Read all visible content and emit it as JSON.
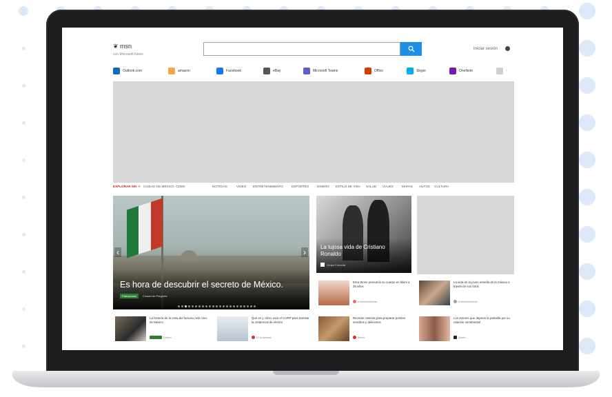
{
  "header": {
    "logo_text": "msn",
    "logo_subtitle": "con Microsoft News",
    "search_placeholder": "",
    "sign_in": "Iniciar sesión"
  },
  "quick_links": [
    {
      "label": "Outlook.com",
      "color": "#0f6cbd"
    },
    {
      "label": "amazon",
      "color": "#f3a847"
    },
    {
      "label": "Facebook",
      "color": "#1877f2"
    },
    {
      "label": "eBay",
      "color": "#555555"
    },
    {
      "label": "Microsoft Teams",
      "color": "#5b5fc7"
    },
    {
      "label": "Office",
      "color": "#d83b01"
    },
    {
      "label": "Skype",
      "color": "#00aff0"
    },
    {
      "label": "OneNote",
      "color": "#7719aa"
    }
  ],
  "categories": {
    "highlight": "EXPLORAR SIN",
    "items": [
      "CIUDAD DE MÉXICO, CDMX",
      "NOTICIAS",
      "VIDEO",
      "ENTRETENIMIENTO",
      "DEPORTES",
      "DINERO",
      "ESTILO DE VIDA",
      "SALUD",
      "VIAJES",
      "MAPAS",
      "AUTOS",
      "CULTURA"
    ]
  },
  "hero": {
    "title": "Es hora de descubrir el secreto de México.",
    "badge": "Patrocinado",
    "source": "Ciudad de Pregunta"
  },
  "feature": {
    "title": "La lujosa vida de Cristiano Ronaldo",
    "source": "Grupo Fórmula"
  },
  "cards": [
    {
      "text": "Ema Stone presumió su cuerpo en bikini a 35 años",
      "meta": "Entretenimiento",
      "meta_color": "#e57373"
    },
    {
      "text": "La vida de la joven estrella de la música a través de sus fotos",
      "meta": "Entretenimiento",
      "meta_color": "#9e9e9e"
    },
    {
      "text": "La historia de la casa del famoso más caro de México",
      "meta": "Dinero",
      "meta_color": "#2e7d32"
    },
    {
      "text": "Qué es y cómo usar el CURP para tramitar la credencial de elector",
      "meta": "El Universal",
      "meta_color": "#d32f2f"
    },
    {
      "text": "Recetas caseras para preparar postres sencillos y deliciosos",
      "meta": "Menú",
      "meta_color": "#d32f2f"
    },
    {
      "text": "Los actores que dejaron la pantalla por su relación sentimental",
      "meta": "Quién",
      "meta_color": "#222222"
    }
  ]
}
